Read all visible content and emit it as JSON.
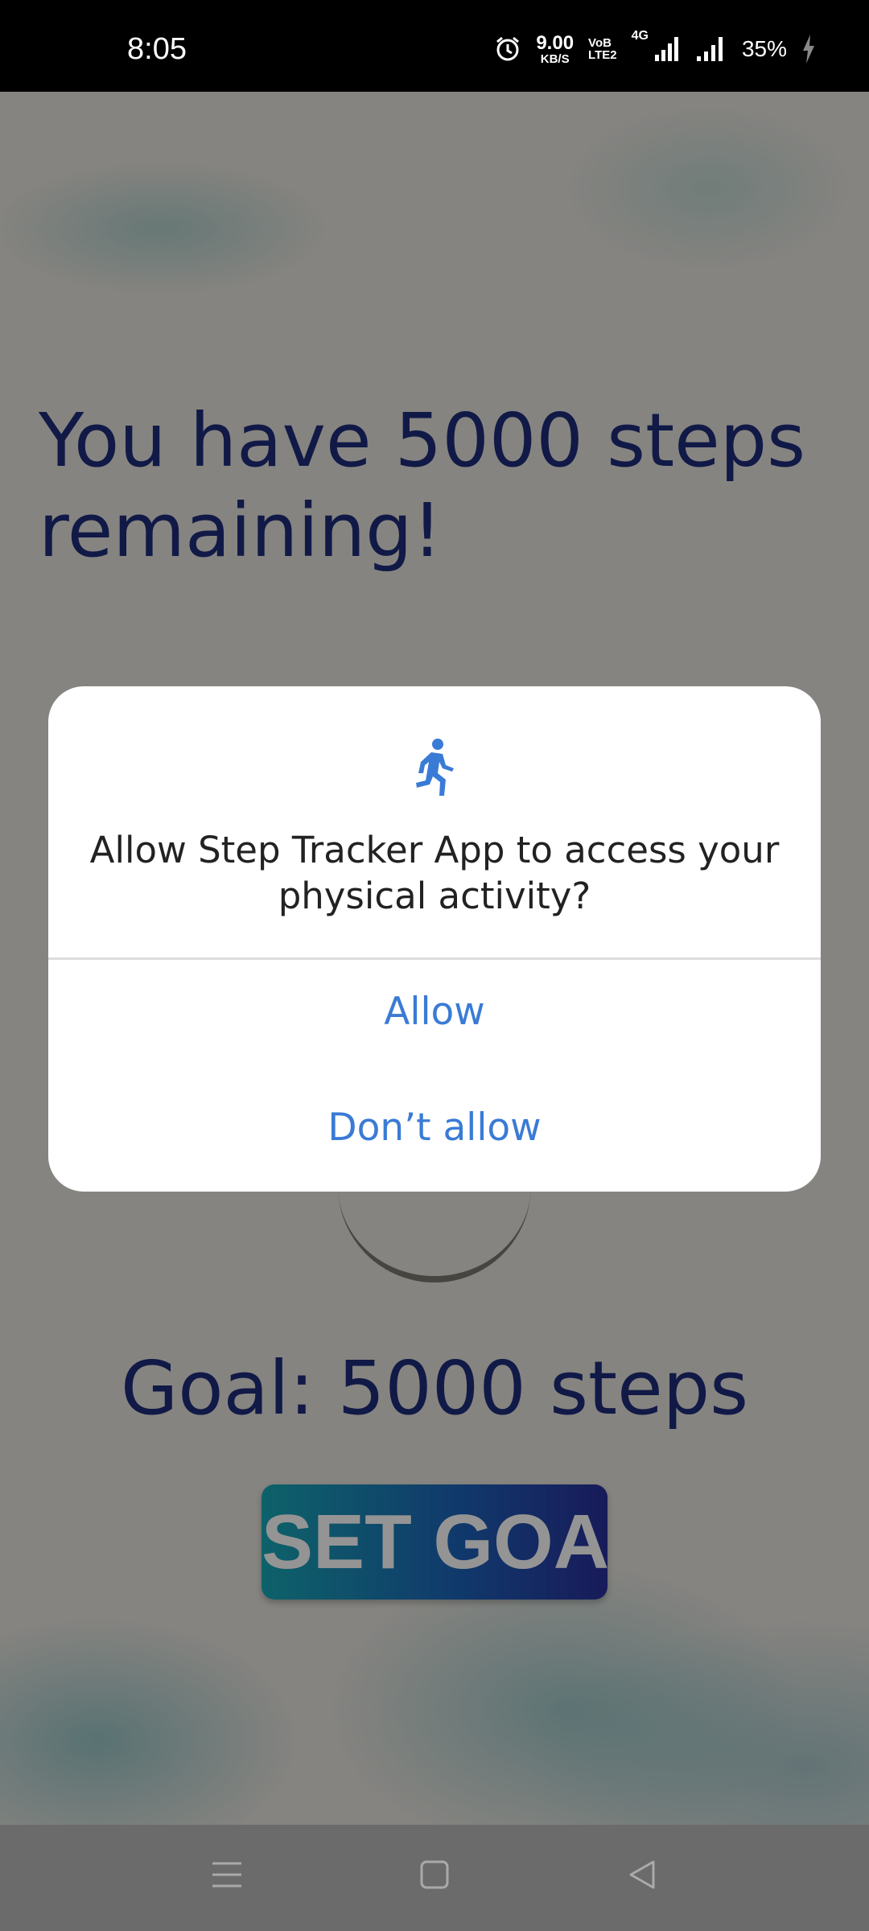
{
  "status_bar": {
    "time": "8:05",
    "net_speed_value": "9.00",
    "net_speed_unit": "KB/S",
    "volte_top": "VoB",
    "volte_bottom": "LTE2",
    "network_type": "4G",
    "battery": "35%"
  },
  "app": {
    "headline": "You have 5000 steps remaining!",
    "goal": "Goal: 5000 steps",
    "set_goal_label": "SET GOAL"
  },
  "dialog": {
    "icon": "directions-run-icon",
    "title": "Allow Step Tracker App to access your physical activity?",
    "allow_label": "Allow",
    "deny_label": "Don’t allow",
    "accent_color": "#3a7bd5"
  },
  "nav_bar": {
    "icons": [
      "menu-icon",
      "home-square-icon",
      "back-triangle-icon"
    ]
  }
}
